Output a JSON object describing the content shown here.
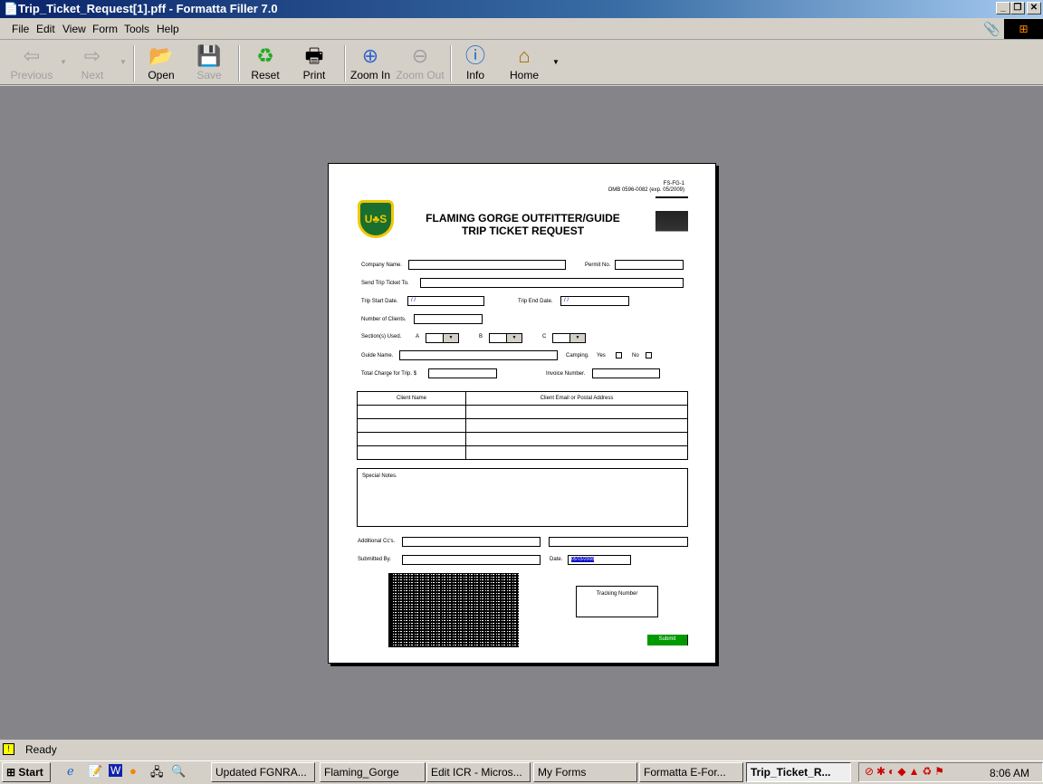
{
  "window": {
    "title": "Trip_Ticket_Request[1].pff - Formatta Filler 7.0"
  },
  "menu": [
    "File",
    "Edit",
    "View",
    "Form",
    "Tools",
    "Help"
  ],
  "toolbar": {
    "previous": "Previous",
    "next": "Next",
    "open": "Open",
    "save": "Save",
    "reset": "Reset",
    "print": "Print",
    "zoom_in": "Zoom In",
    "zoom_out": "Zoom Out",
    "info": "Info",
    "home": "Home"
  },
  "form": {
    "form_id": "FS-FG-1",
    "omb": "OMB 0596-0082 (exp. 05/2009)",
    "title1": "FLAMING GORGE OUTFITTER/GUIDE",
    "title2": "TRIP TICKET REQUEST",
    "logo_left": "US FOREST SERVICE",
    "logo_right": "FLAMING GORGE",
    "company_name": "Company Name.",
    "permit_no": "Permit No.",
    "send_to": "Send Trip Ticket To.",
    "start_date": "Trip Start Date.",
    "start_value": "/ /",
    "end_date": "Trip End Date.",
    "end_value": "/ /",
    "num_clients": "Number of Clients.",
    "sections": "Section(s) Used.",
    "sec_a": "A",
    "sec_b": "B",
    "sec_c": "C",
    "guide_name": "Guide Name.",
    "camping": "Camping.",
    "yes": "Yes",
    "no": "No",
    "total_charge": "Total Charge for Trip. $",
    "invoice": "Invoice Number.",
    "table_headers": [
      "Client Name",
      "Client Email or Postal Address"
    ],
    "special_notes": "Special Notes.",
    "additional_cc": "Additional Cc's.",
    "submitted_by": "Submitted By.",
    "date": "Date.",
    "date_value": "05/15/2008",
    "tracking": "Tracking Number",
    "submit": "Submit"
  },
  "status": {
    "text": "Ready"
  },
  "taskbar": {
    "start": "Start",
    "tasks": [
      "Updated FGNRA...",
      "Flaming_Gorge",
      "Edit ICR - Micros...",
      "My Forms",
      "Formatta E-For...",
      "Trip_Ticket_R..."
    ],
    "clock": "8:06 AM"
  }
}
